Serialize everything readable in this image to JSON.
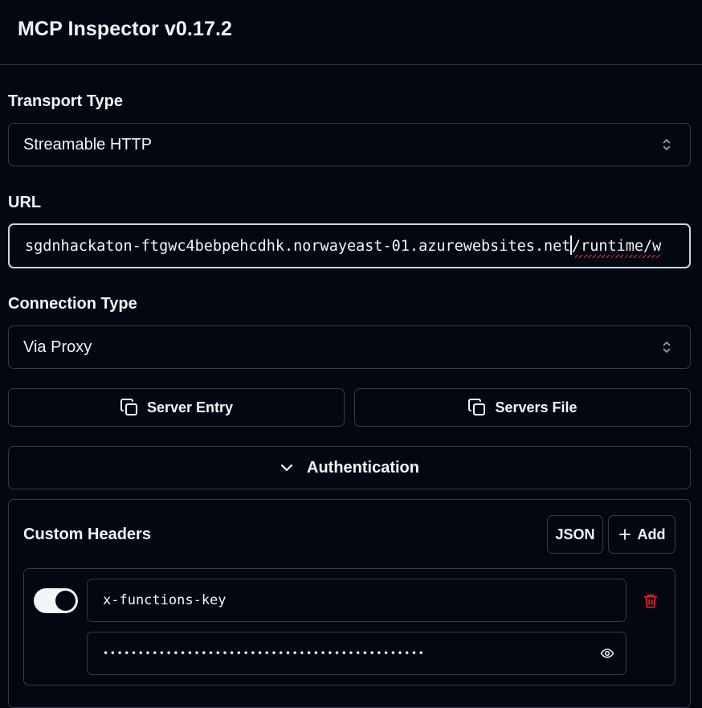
{
  "app": {
    "title": "MCP Inspector v0.17.2"
  },
  "transport": {
    "label": "Transport Type",
    "value": "Streamable HTTP"
  },
  "url": {
    "label": "URL",
    "value_part1": "sgdnhackaton-ftgwc4bebpehcdhk.norwayeast-01.azurewebsites.net",
    "value_part2": "/runtime/w"
  },
  "connection": {
    "label": "Connection Type",
    "value": "Via Proxy"
  },
  "buttons": {
    "server_entry": "Server Entry",
    "servers_file": "Servers File",
    "authentication": "Authentication"
  },
  "custom_headers": {
    "title": "Custom Headers",
    "json_label": "JSON",
    "add_label": "Add",
    "rows": [
      {
        "enabled": true,
        "name": "x-functions-key",
        "value_masked": "••••••••••••••••••••••••••••••••••••••••••••••"
      }
    ]
  },
  "colors": {
    "background": "#030712",
    "border": "#353b47",
    "delete": "#dc2626"
  }
}
